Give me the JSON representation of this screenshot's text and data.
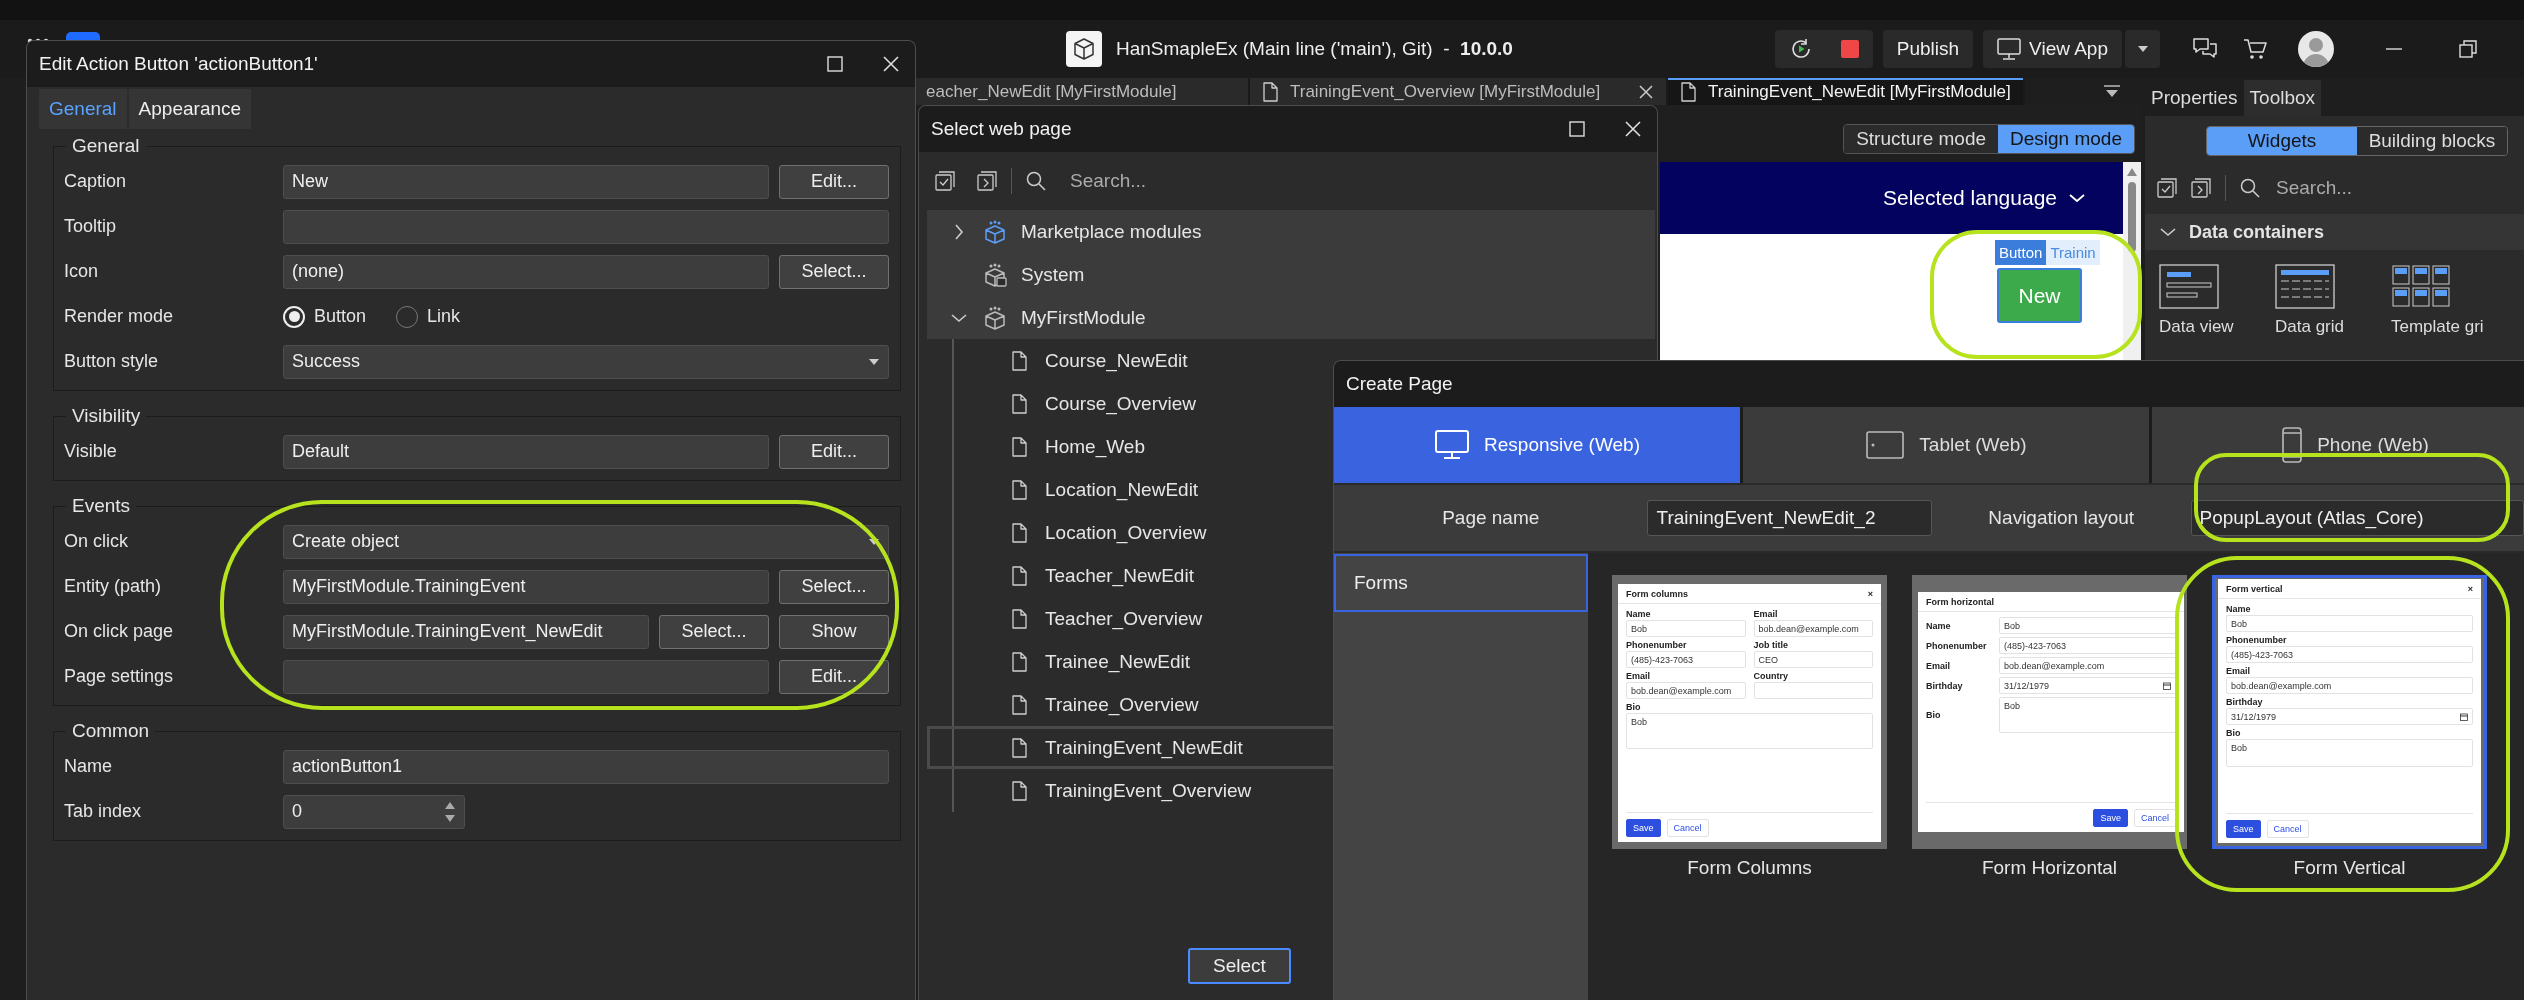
{
  "top_bar": {
    "title": "HanSmapleEx (Main line ('main'), Git)  -  **10.0.0**",
    "buttons": [
      {
        "label": "Publish",
        "kind": "plain"
      },
      {
        "label": "View App",
        "kind": "split"
      }
    ]
  },
  "document_tabs": [
    {
      "label": "eacher_NewEdit [MyFirstModule]",
      "selected": false,
      "closable": false
    },
    {
      "label": "TrainingEvent_Overview [MyFirstModule]",
      "selected": false,
      "closable": true
    },
    {
      "label": "TrainingEvent_NewEdit [MyFirstModule]",
      "selected": true,
      "closable": false
    }
  ],
  "design_canvas": {
    "modes": [
      {
        "label": "Structure mode",
        "selected": false
      },
      {
        "label": "Design mode",
        "selected": true
      }
    ],
    "language_menu": "Selected language",
    "widget_tag": "Button",
    "tab_label": "Trainin",
    "button_caption": "New"
  },
  "toolbox_panel": {
    "tabs": [
      {
        "label": "Properties",
        "selected": false
      },
      {
        "label": "Toolbox",
        "selected": true
      }
    ],
    "segments": [
      {
        "label": "Widgets",
        "selected": true
      },
      {
        "label": "Building blocks",
        "selected": false
      }
    ],
    "search": {
      "placeholder": "Search..."
    },
    "section": {
      "title": "Data containers",
      "expanded": true
    },
    "widgets": [
      {
        "label": "Data view",
        "kind": "data_view"
      },
      {
        "label": "Data grid",
        "kind": "data_grid"
      },
      {
        "label": "Template gri",
        "kind": "template_grid"
      }
    ]
  },
  "edit_action_dialog": {
    "title": "Edit Action Button 'actionButton1'",
    "tabs": [
      {
        "label": "General",
        "selected": true
      },
      {
        "label": "Appearance",
        "selected": false
      }
    ],
    "groups": [
      {
        "title": "General",
        "rows": [
          {
            "label": "Caption",
            "kind": "text",
            "value": "New",
            "buttons": [
              "Edit..."
            ]
          },
          {
            "label": "Tooltip",
            "kind": "text"
          },
          {
            "label": "Icon",
            "kind": "text",
            "value": "(none)",
            "buttons": [
              "Select..."
            ]
          },
          {
            "label": "Render mode",
            "kind": "radio",
            "options": [
              {
                "label": "Button",
                "selected": true
              },
              {
                "label": "Link",
                "selected": false
              }
            ]
          },
          {
            "label": "Button style",
            "kind": "dropdown",
            "value": "Success"
          }
        ]
      },
      {
        "title": "Visibility",
        "rows": [
          {
            "label": "Visible",
            "kind": "text",
            "value": "Default",
            "buttons": [
              "Edit..."
            ]
          }
        ]
      },
      {
        "title": "Events",
        "rows": [
          {
            "label": "On click",
            "kind": "dropdown",
            "value": "Create object"
          },
          {
            "label": "Entity (path)",
            "kind": "text",
            "value": "MyFirstModule.TrainingEvent",
            "buttons": [
              "Select..."
            ]
          },
          {
            "label": "On click page",
            "kind": "text",
            "value": "MyFirstModule.TrainingEvent_NewEdit",
            "buttons": [
              "Select...",
              "Show"
            ]
          },
          {
            "label": "Page settings",
            "kind": "text",
            "buttons": [
              "Edit..."
            ]
          }
        ]
      },
      {
        "title": "Common",
        "rows": [
          {
            "label": "Name",
            "kind": "text",
            "value": "actionButton1"
          },
          {
            "label": "Tab index",
            "kind": "spinner",
            "value": "0"
          }
        ]
      }
    ]
  },
  "select_page_dialog": {
    "title": "Select web page",
    "search": {
      "placeholder": "Search..."
    },
    "tree": [
      {
        "label": "Marketplace modules",
        "kind": "marketplace",
        "expanded": false,
        "selected": false
      },
      {
        "label": "System",
        "kind": "system",
        "selected": false
      },
      {
        "label": "MyFirstModule",
        "kind": "module",
        "expanded": true,
        "selected": false,
        "children": [
          {
            "label": "Course_NewEdit",
            "kind": "page",
            "selected": false
          },
          {
            "label": "Course_Overview",
            "kind": "page",
            "selected": false
          },
          {
            "label": "Home_Web",
            "kind": "page",
            "selected": false
          },
          {
            "label": "Location_NewEdit",
            "kind": "page",
            "selected": false
          },
          {
            "label": "Location_Overview",
            "kind": "page",
            "selected": false
          },
          {
            "label": "Teacher_NewEdit",
            "kind": "page",
            "selected": false
          },
          {
            "label": "Teacher_Overview",
            "kind": "page",
            "selected": false
          },
          {
            "label": "Trainee_NewEdit",
            "kind": "page",
            "selected": false
          },
          {
            "label": "Trainee_Overview",
            "kind": "page",
            "selected": false
          },
          {
            "label": "TrainingEvent_NewEdit",
            "kind": "page",
            "selected": true
          },
          {
            "label": "TrainingEvent_Overview",
            "kind": "page",
            "selected": false
          }
        ]
      }
    ],
    "buttons": [
      "Select"
    ]
  },
  "create_page_dialog": {
    "title": "Create Page",
    "devices": [
      {
        "label": "Responsive (Web)",
        "kind": "desktop",
        "selected": true
      },
      {
        "label": "Tablet (Web)",
        "kind": "tablet",
        "selected": false
      },
      {
        "label": "Phone (Web)",
        "kind": "phone",
        "selected": false
      }
    ],
    "page_name": {
      "label": "Page name",
      "value": "TrainingEvent_NewEdit_2"
    },
    "navigation_layout": {
      "label": "Navigation layout",
      "value": "PopupLayout (Atlas_Core)"
    },
    "categories": [
      {
        "label": "Forms",
        "selected": true
      }
    ],
    "templates": [
      {
        "label": "Form Columns",
        "selected": false,
        "preview": {
          "kind": "columns",
          "title": "Form columns",
          "close": "×",
          "fields": [
            {
              "label": "Name",
              "kind": "text",
              "value": "Bob"
            },
            {
              "label": "Email",
              "kind": "text",
              "value": "bob.dean@example.com"
            },
            {
              "label": "Phonenumber",
              "kind": "text",
              "value": "(485)-423-7063"
            },
            {
              "label": "Job title",
              "kind": "text",
              "value": "CEO"
            },
            {
              "label": "Email",
              "kind": "text",
              "value": "bob.dean@example.com"
            },
            {
              "label": "Country",
              "kind": "text"
            },
            {
              "label": "Bio",
              "kind": "textarea",
              "value": "Bob"
            }
          ],
          "buttons": [
            {
              "label": "Save",
              "kind": "primary"
            },
            {
              "label": "Cancel",
              "kind": "secondary"
            }
          ]
        }
      },
      {
        "label": "Form Horizontal",
        "selected": false,
        "preview": {
          "kind": "horizontal",
          "title": "Form horizontal",
          "fields": [
            {
              "label": "Name",
              "kind": "text",
              "value": "Bob"
            },
            {
              "label": "Phonenumber",
              "kind": "text",
              "value": "(485)-423-7063"
            },
            {
              "label": "Email",
              "kind": "text",
              "value": "bob.dean@example.com"
            },
            {
              "label": "Birthday",
              "kind": "date",
              "value": "31/12/1979"
            },
            {
              "label": "Bio",
              "kind": "textarea",
              "value": "Bob"
            }
          ],
          "buttons": [
            {
              "label": "Save",
              "kind": "primary"
            },
            {
              "label": "Cancel",
              "kind": "secondary"
            }
          ]
        }
      },
      {
        "label": "Form Vertical",
        "selected": true,
        "preview": {
          "kind": "vertical",
          "title": "Form vertical",
          "close": "×",
          "fields": [
            {
              "label": "Name",
              "kind": "text",
              "value": "Bob"
            },
            {
              "label": "Phonenumber",
              "kind": "text",
              "value": "(485)-423-7063"
            },
            {
              "label": "Email",
              "kind": "text",
              "value": "bob.dean@example.com"
            },
            {
              "label": "Birthday",
              "kind": "date",
              "value": "31/12/1979"
            },
            {
              "label": "Bio",
              "kind": "textarea",
              "value": "Bob"
            }
          ],
          "buttons": [
            {
              "label": "Save",
              "kind": "primary"
            },
            {
              "label": "Cancel",
              "kind": "secondary"
            }
          ]
        }
      }
    ]
  }
}
